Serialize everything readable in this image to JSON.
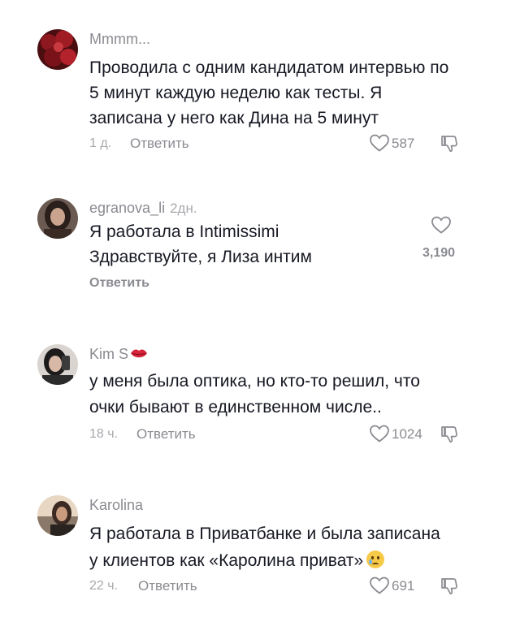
{
  "comments": [
    {
      "username": "Mmmm...",
      "time": "",
      "lines": [
        "Проводила с одним кандидатом интервью по",
        "5 минут каждую неделю как тесты. Я",
        "записана у него как Дина на 5 минут"
      ],
      "meta_time": "1 д.",
      "reply_label": "Ответить",
      "likes": "587",
      "avatar_icon": "avatar-red-roses",
      "has_dislike": true
    },
    {
      "username": "egranova_li",
      "time": "2дн.",
      "lines": [
        "Я работала в Intimissimi",
        "Здравствуйте, я Лиза интим"
      ],
      "meta_time": "",
      "reply_label": "Ответить",
      "likes": "3,190",
      "avatar_icon": "avatar-woman-dark-hair",
      "has_dislike": false
    },
    {
      "username": "Kim S",
      "time": "",
      "username_emoji": "lips-emoji",
      "lines": [
        "у меня была оптика, но кто-то решил, что",
        "очки бывают в единственном числе.."
      ],
      "meta_time": "18 ч.",
      "reply_label": "Ответить",
      "likes": "1024",
      "avatar_icon": "avatar-woman-selfie",
      "has_dislike": true
    },
    {
      "username": "Karolina",
      "time": "",
      "lines": [
        "Я работала в Приватбанке и была записана",
        "у клиентов как «Каролина приват»"
      ],
      "line_emoji": "crying-face-emoji",
      "meta_time": "22 ч.",
      "reply_label": "Ответить",
      "likes": "691",
      "avatar_icon": "avatar-woman-sunset",
      "has_dislike": true
    }
  ],
  "colors": {
    "text_primary": "#161823",
    "text_secondary": "#8a8b91",
    "text_muted": "#a8a9ad",
    "icon": "#8a8b91"
  }
}
